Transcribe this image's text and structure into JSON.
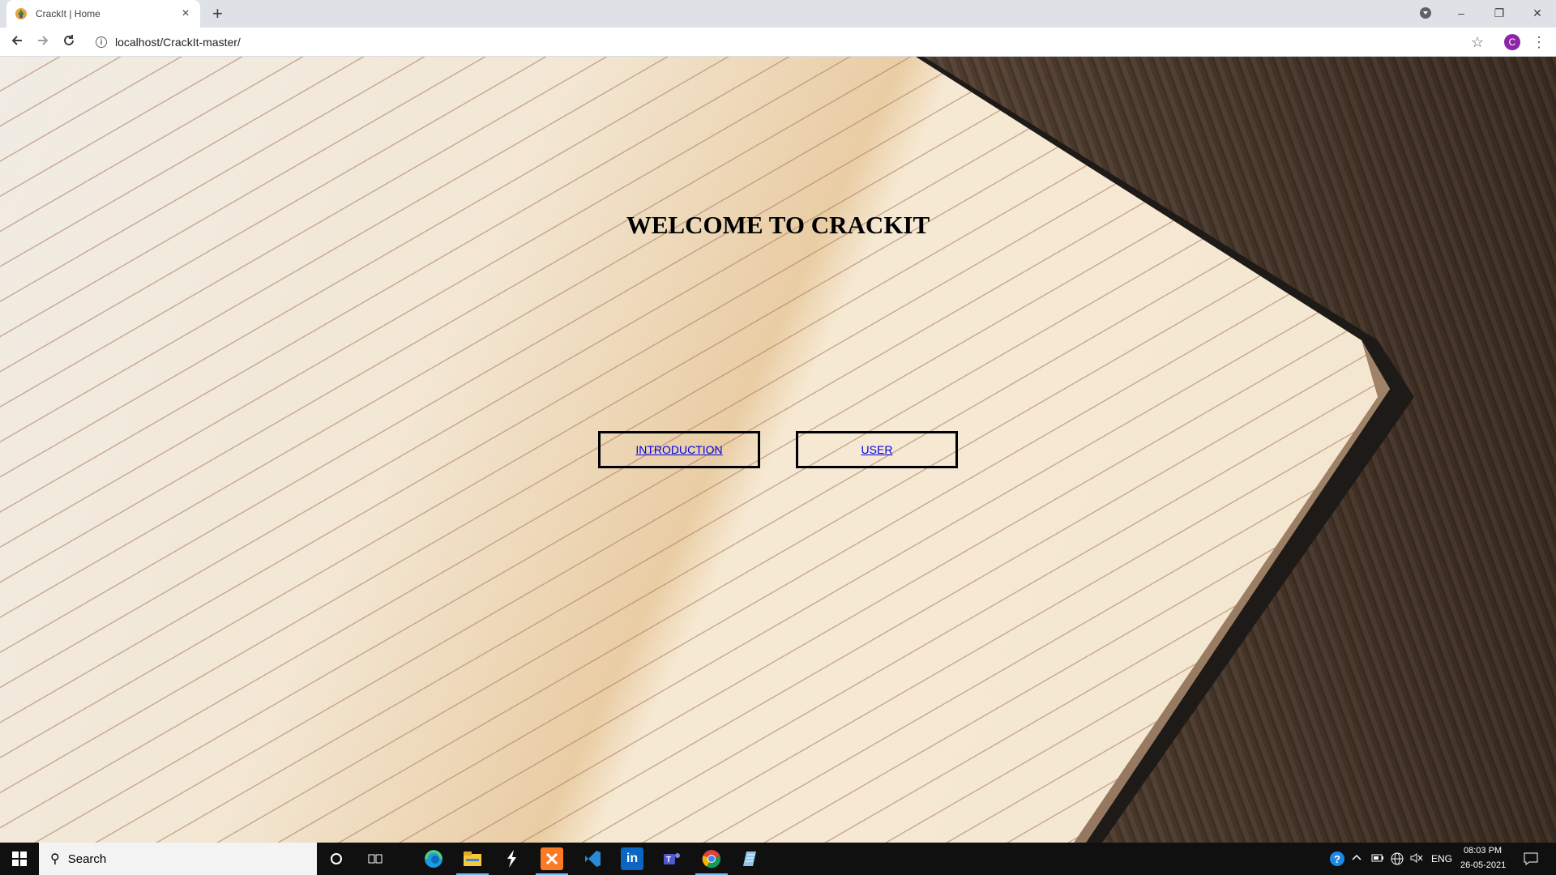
{
  "browser": {
    "tab_title": "CrackIt | Home",
    "tab_close": "×",
    "new_tab": "+",
    "url": "localhost/CrackIt-master/",
    "window_controls": {
      "minimize": "–",
      "restore": "❐",
      "close": "✕"
    },
    "profile_initial": "C",
    "icons": {
      "back": "arrow-left-icon",
      "forward": "arrow-right-icon",
      "reload": "reload-icon",
      "info": "info-icon",
      "bookmark": "star-icon",
      "menu": "kebab-menu-icon"
    }
  },
  "page": {
    "heading": "WELCOME TO CRACKIT",
    "nav": [
      {
        "label": "INTRODUCTION"
      },
      {
        "label": "USER"
      }
    ],
    "separator_link": " ",
    "link_color": "#0000ee"
  },
  "taskbar": {
    "search_placeholder": "Search",
    "apps": [
      "cortana-icon",
      "task-view-icon",
      "edge-icon",
      "file-explorer-icon",
      "sublime-text-icon",
      "xampp-icon",
      "vscode-icon",
      "linkedin-icon",
      "teams-icon",
      "chrome-icon",
      "notepad-icon"
    ],
    "tray": {
      "language": "ENG",
      "time": "08:03 PM",
      "date": "26-05-2021"
    }
  }
}
